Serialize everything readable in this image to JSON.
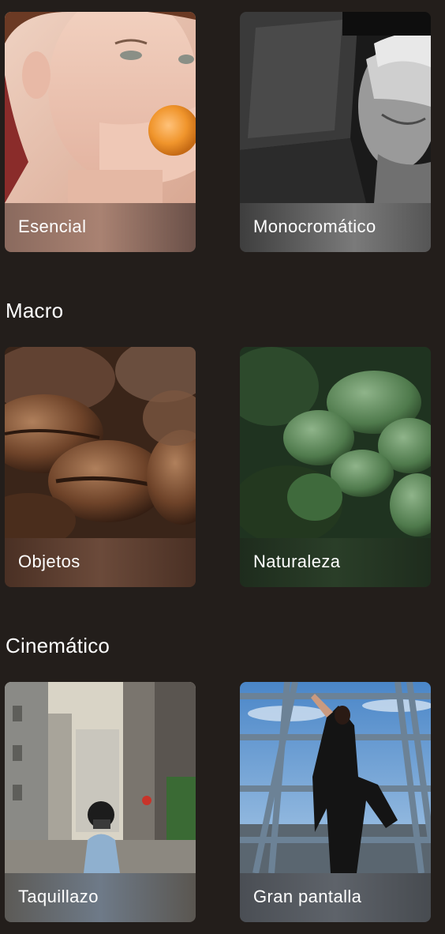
{
  "sections": [
    {
      "title": "",
      "cards": [
        {
          "label": "Esencial",
          "thumbnail": "portrait-bubblegum"
        },
        {
          "label": "Monocromático",
          "thumbnail": "portrait-monochrome"
        }
      ]
    },
    {
      "title": "Macro",
      "cards": [
        {
          "label": "Objetos",
          "thumbnail": "coffee-beans"
        },
        {
          "label": "Naturaleza",
          "thumbnail": "succulent-leaves"
        }
      ]
    },
    {
      "title": "Cinemático",
      "cards": [
        {
          "label": "Taquillazo",
          "thumbnail": "street-photographer"
        },
        {
          "label": "Gran pantalla",
          "thumbnail": "dancer-on-tower"
        }
      ]
    }
  ],
  "colors": {
    "background": "#231e1b",
    "text": "#ffffff"
  }
}
